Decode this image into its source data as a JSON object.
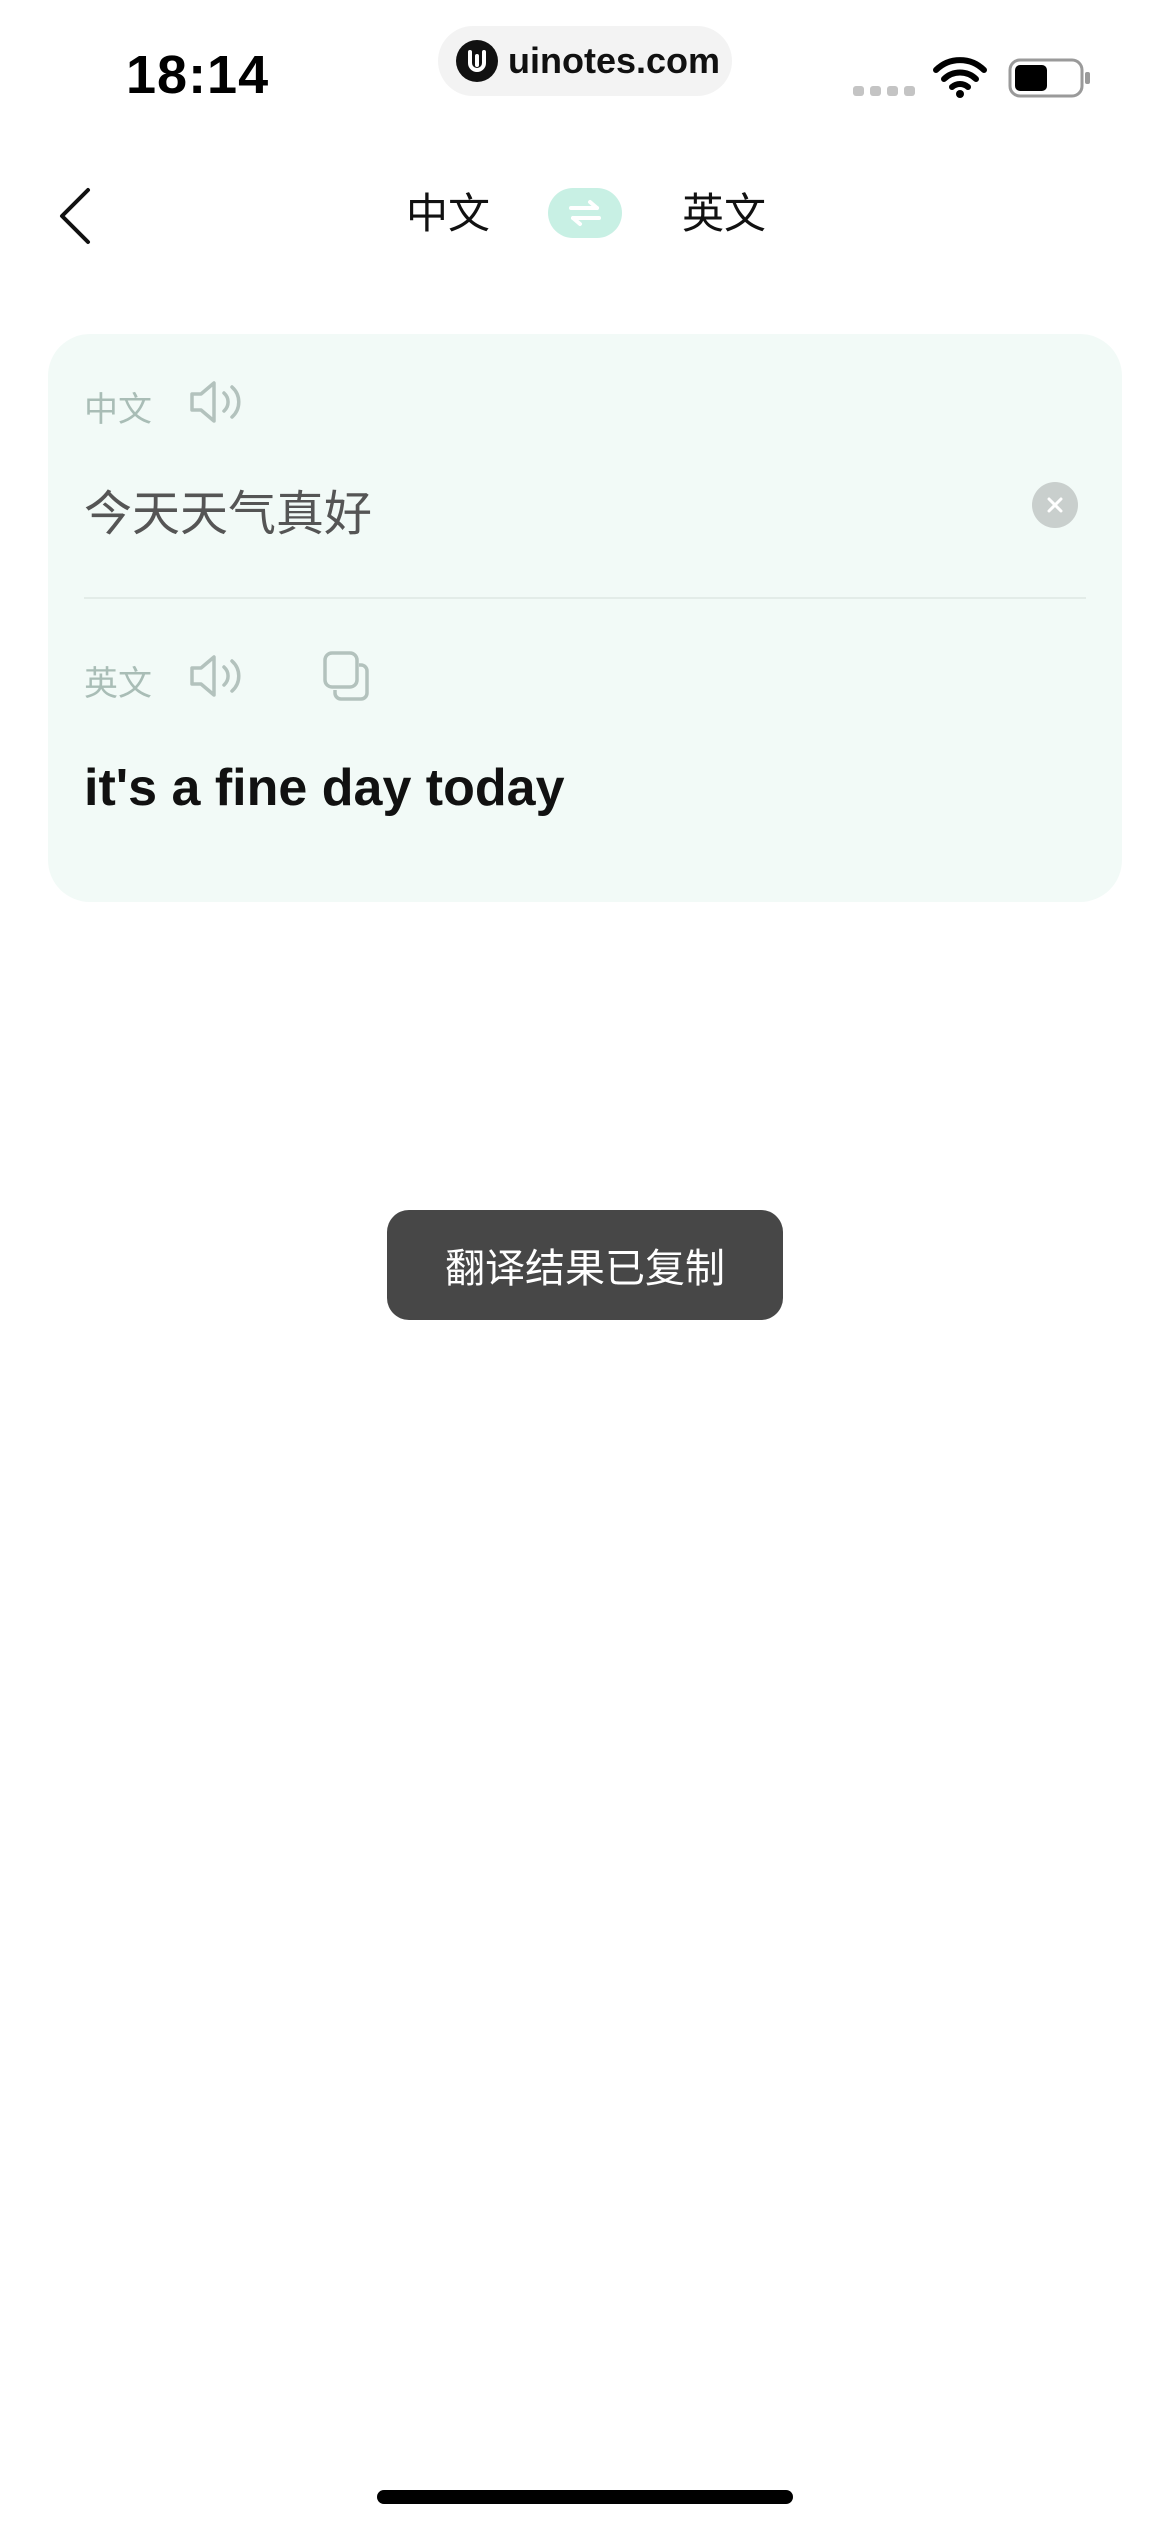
{
  "status_bar": {
    "time": "18:14",
    "url": "uinotes.com"
  },
  "nav": {
    "source_language": "中文",
    "target_language": "英文"
  },
  "card": {
    "source_label": "中文",
    "source_text": "今天天气真好",
    "target_label": "英文",
    "translated_text": "it's a fine day today"
  },
  "toast": {
    "message": "翻译结果已复制"
  },
  "colors": {
    "accent_swap_bg": "#c8f0e4",
    "card_bg": "#f2faf7",
    "toast_bg": "#474747"
  }
}
